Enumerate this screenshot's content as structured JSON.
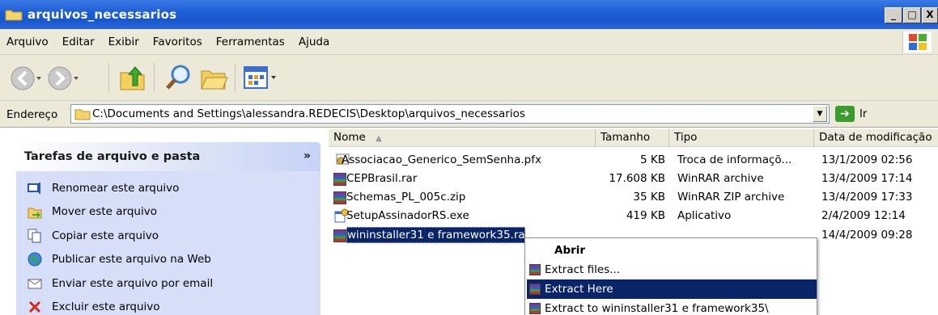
{
  "window": {
    "title": "arquivos_necessarios",
    "controls": {
      "minimize": "_",
      "maximize": "□",
      "close": "X"
    }
  },
  "menubar": {
    "items": [
      "Arquivo",
      "Editar",
      "Exibir",
      "Favoritos",
      "Ferramentas",
      "Ajuda"
    ]
  },
  "toolbar": {
    "buttons": [
      "back-icon",
      "forward-icon",
      "up-folder-icon",
      "search-icon",
      "folders-icon",
      "views-icon"
    ]
  },
  "addressbar": {
    "label": "Endereço",
    "path": "C:\\Documents and Settings\\alessandra.REDECIS\\Desktop\\arquivos_necessarios",
    "go_label": "Ir"
  },
  "tasks": {
    "header": "Tarefas de arquivo e pasta",
    "chevron": "»",
    "items": [
      "Renomear este arquivo",
      "Mover este arquivo",
      "Copiar este arquivo",
      "Publicar este arquivo na Web",
      "Enviar este arquivo por email",
      "Excluir este arquivo"
    ]
  },
  "columns": {
    "name": "Nome",
    "size": "Tamanho",
    "type": "Tipo",
    "date": "Data de modificação"
  },
  "files": [
    {
      "name": "Associacao_Generico_SemSenha.pfx",
      "size": "5 KB",
      "type": "Troca de informaçõ...",
      "date": "13/1/2009 02:56",
      "icon": "certificate-icon"
    },
    {
      "name": "CEPBrasil.rar",
      "size": "17.608 KB",
      "type": "WinRAR archive",
      "date": "13/4/2009 17:14",
      "icon": "winrar-icon"
    },
    {
      "name": "Schemas_PL_005c.zip",
      "size": "35 KB",
      "type": "WinRAR ZIP archive",
      "date": "13/4/2009 17:33",
      "icon": "winrar-icon"
    },
    {
      "name": "SetupAssinadorRS.exe",
      "size": "419 KB",
      "type": "Aplicativo",
      "date": "2/4/2009 12:14",
      "icon": "installer-icon"
    },
    {
      "name": "wininstaller31 e framework35.ra",
      "size": "",
      "type": "",
      "date": "14/4/2009 09:28",
      "icon": "winrar-icon"
    }
  ],
  "context_menu": {
    "items": [
      "Abrir",
      "Extract files...",
      "Extract Here",
      "Extract to wininstaller31 e framework35\\"
    ],
    "highlighted": "Extract Here"
  },
  "colors": {
    "title_blue": "#1957cf",
    "selection": "#0a246a",
    "task_body": "#d6dff7"
  }
}
